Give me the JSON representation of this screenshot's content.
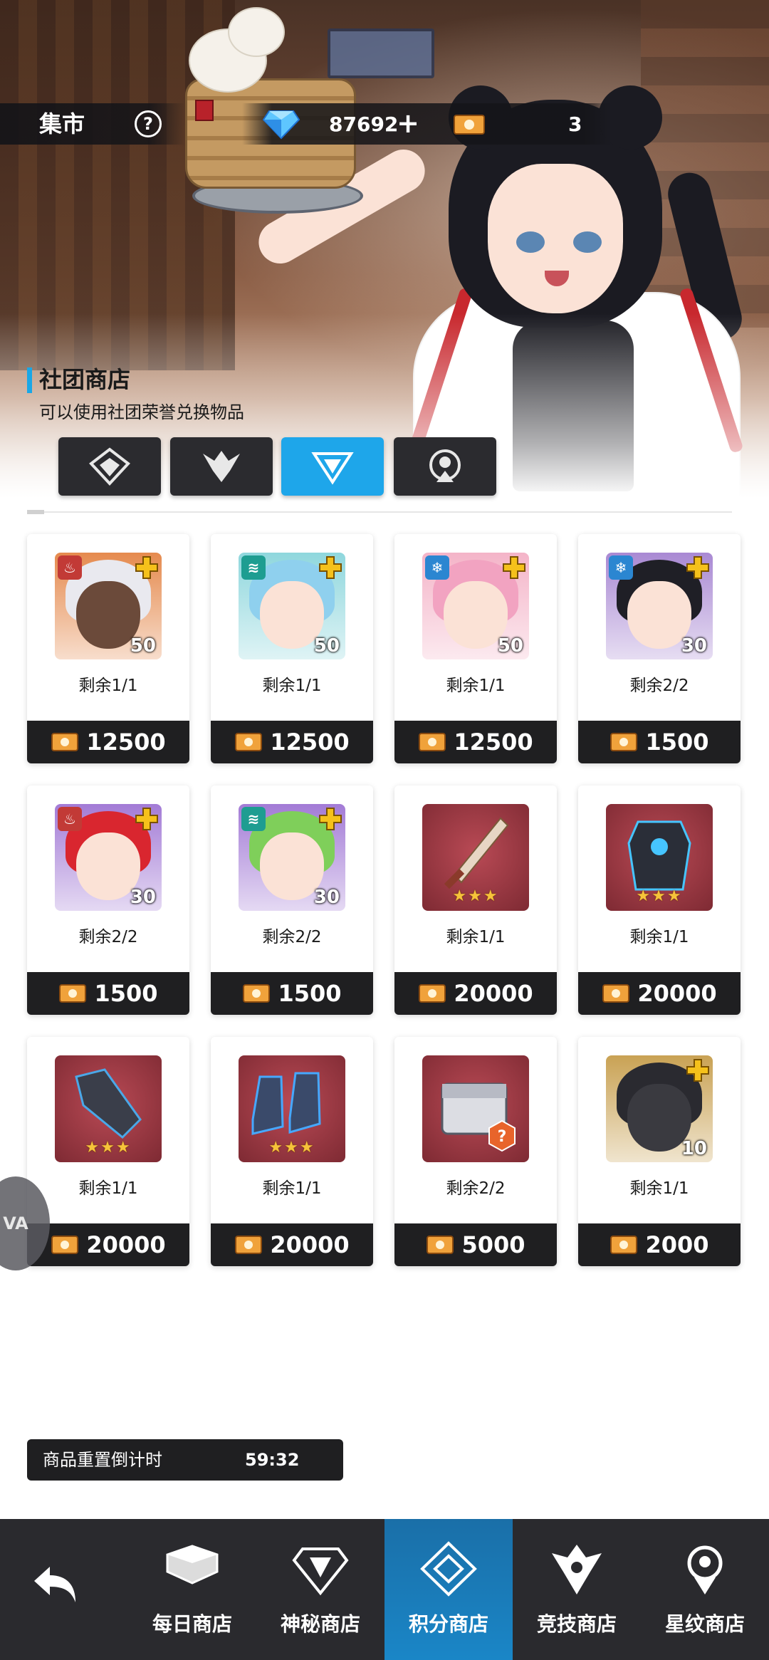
{
  "header": {
    "title": "集市",
    "help_icon": "?",
    "diamonds": "87692",
    "add_icon": "+",
    "tickets": "3"
  },
  "shop": {
    "title": "社团商店",
    "subtitle": "可以使用社团荣誉兑换物品",
    "tabs": [
      {
        "icon": "trophy-emblem-icon",
        "active": false
      },
      {
        "icon": "wings-emblem-icon",
        "active": false
      },
      {
        "icon": "shield-emblem-icon",
        "active": true
      },
      {
        "icon": "circle-emblem-icon",
        "active": false
      }
    ]
  },
  "items": [
    {
      "type": "hero",
      "element": "fire",
      "level": "50",
      "stock": "剩余1/1",
      "price": "12500",
      "color": "#c23a36"
    },
    {
      "type": "hero",
      "element": "water",
      "level": "50",
      "stock": "剩余1/1",
      "price": "12500",
      "color": "#1e9d91"
    },
    {
      "type": "hero",
      "element": "ice",
      "level": "50",
      "stock": "剩余1/1",
      "price": "12500",
      "color": "#2b86d1"
    },
    {
      "type": "hero",
      "element": "ice",
      "level": "30",
      "stock": "剩余2/2",
      "price": "1500",
      "color": "#2b86d1"
    },
    {
      "type": "hero",
      "element": "fire",
      "level": "30",
      "stock": "剩余2/2",
      "price": "1500",
      "color": "#c23a36"
    },
    {
      "type": "hero",
      "element": "water",
      "level": "30",
      "stock": "剩余2/2",
      "price": "1500",
      "color": "#1e9d91"
    },
    {
      "type": "gear",
      "gear": "sword",
      "stars": "★★★",
      "stock": "剩余1/1",
      "price": "20000"
    },
    {
      "type": "gear",
      "gear": "armor",
      "stars": "★★★",
      "stock": "剩余1/1",
      "price": "20000"
    },
    {
      "type": "gear",
      "gear": "gauntlet",
      "stars": "★★★",
      "stock": "剩余1/1",
      "price": "20000"
    },
    {
      "type": "gear",
      "gear": "boots",
      "stars": "★★★",
      "stock": "剩余1/1",
      "price": "20000"
    },
    {
      "type": "box",
      "stock": "剩余2/2",
      "price": "5000"
    },
    {
      "type": "hero",
      "element": "none",
      "level": "10",
      "stock": "剩余1/1",
      "price": "2000",
      "color": "#b88a3a"
    }
  ],
  "timer": {
    "label": "商品重置倒计时",
    "value": "59:32"
  },
  "float_button": "VA",
  "nav": {
    "back_icon": "back-arrow-icon",
    "items": [
      {
        "label": "每日商店",
        "active": false
      },
      {
        "label": "神秘商店",
        "active": false
      },
      {
        "label": "积分商店",
        "active": true
      },
      {
        "label": "竞技商店",
        "active": false
      },
      {
        "label": "星纹商店",
        "active": false
      }
    ]
  },
  "colors": {
    "accent": "#1ea6ea",
    "dark": "#1f1f21",
    "nav_bg": "#2a2a2e"
  }
}
